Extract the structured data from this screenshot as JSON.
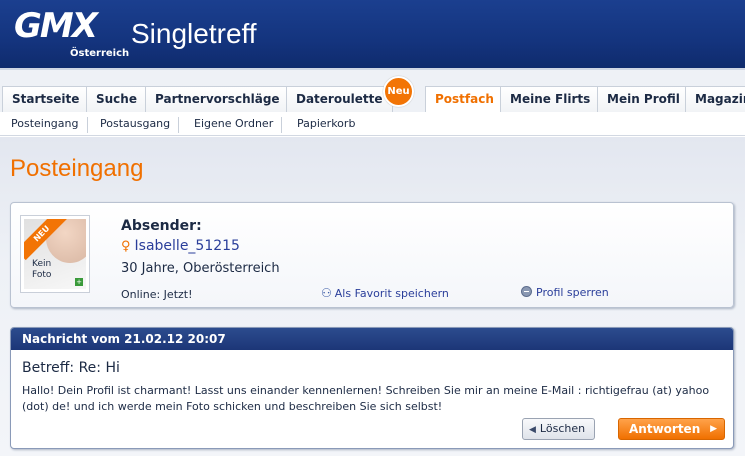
{
  "header": {
    "logo": "GMX",
    "logo_sub": "Österreich",
    "brand": "Singletreff"
  },
  "tabs": [
    {
      "label": "Startseite"
    },
    {
      "label": "Suche"
    },
    {
      "label": "Partnervorschläge"
    },
    {
      "label": "Dateroulette"
    },
    {
      "label": "Postfach",
      "active": true
    },
    {
      "label": "Meine Flirts"
    },
    {
      "label": "Mein Profil"
    },
    {
      "label": "Magazin"
    }
  ],
  "tab_badge": "Neu",
  "subnav": [
    {
      "label": "Posteingang"
    },
    {
      "label": "Postausgang"
    },
    {
      "label": "Eigene Ordner"
    },
    {
      "label": "Papierkorb"
    }
  ],
  "page_title": "Posteingang",
  "sender": {
    "photo_ribbon": "NEU",
    "photo_text": "Kein Foto",
    "label": "Absender:",
    "name": "Isabelle_51215",
    "age_location": "30 Jahre, Oberösterreich",
    "online": "Online: Jetzt!",
    "favorite_link": "Als Favorit speichern",
    "block_link": "Profil sperren"
  },
  "message": {
    "header": "Nachricht vom 21.02.12 20:07",
    "subject": "Betreff: Re: Hi",
    "body": "Hallo! Dein Profil ist charmant! Lasst uns einander kennenlernen! Schreiben Sie mir an meine E-Mail : richtigefrau (at) yahoo (dot) de! und ich werde mein Foto schicken und beschreiben Sie sich selbst!",
    "delete_button": "Löschen",
    "reply_button": "Antworten"
  },
  "colors": {
    "header_blue": "#14347e",
    "accent_orange": "#f07000",
    "link_blue": "#2a3e9a"
  }
}
